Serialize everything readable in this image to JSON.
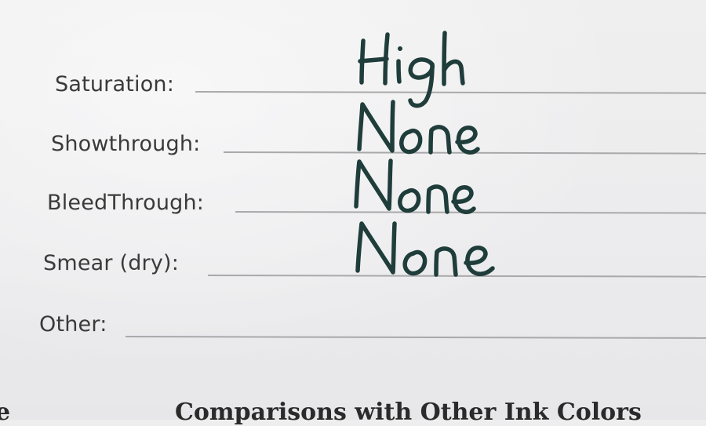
{
  "form": {
    "fields": [
      {
        "label": "Saturation:",
        "value": "High"
      },
      {
        "label": "Showthrough:",
        "value": "None"
      },
      {
        "label": "BleedThrough:",
        "value": "None"
      },
      {
        "label": "Smear (dry):",
        "value": "None"
      },
      {
        "label": "Other:",
        "value": ""
      }
    ],
    "section_heading": "Comparisons with Other Ink Colors",
    "section_heading_prefix": "e"
  },
  "colors": {
    "ink": "#1f3d3a",
    "paper": "#eeeeef",
    "rule": "#a9a9ab",
    "label_text": "#3a3a3a"
  }
}
